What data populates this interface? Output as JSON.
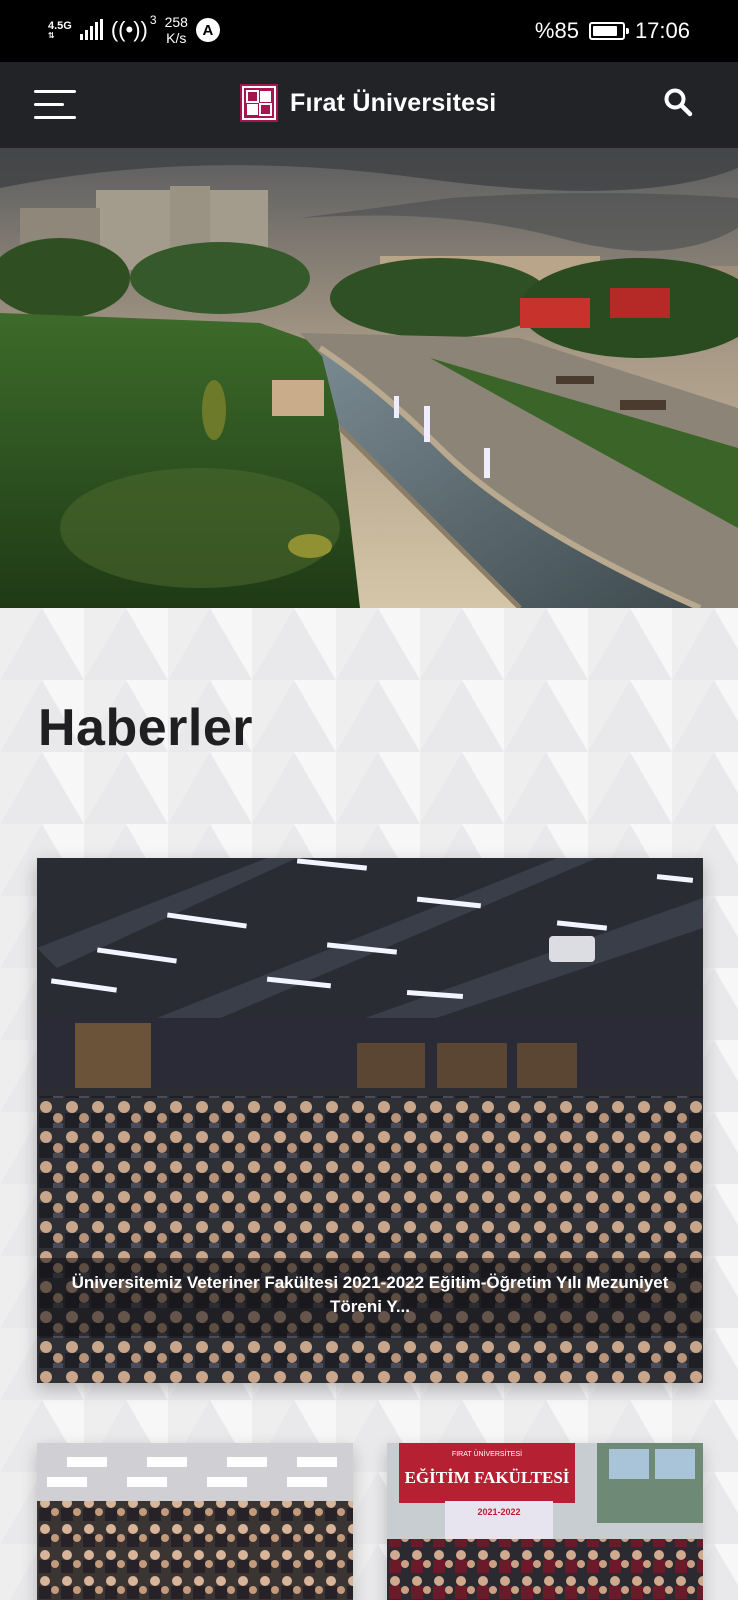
{
  "status_bar": {
    "network": "4.5G",
    "hotspot_count": "3",
    "speed_value": "258",
    "speed_unit": "K/s",
    "notification_glyph": "A",
    "battery": "%85",
    "battery_level": 0.85,
    "time": "17:06"
  },
  "header": {
    "brand": "Fırat Üniversitesi",
    "menu_icon": "hamburger-menu-icon",
    "search_icon": "search-icon"
  },
  "colors": {
    "header_bg": "#222327",
    "logo_accent": "#a3164f",
    "page_bg": "#f3f3f4"
  },
  "news": {
    "title": "Haberler",
    "featured": {
      "caption": "Üniversitemiz Veteriner Fakültesi 2021-2022 Eğitim-Öğretim Yılı Mezuniyet Töreni Y..."
    },
    "small_cards": [
      {
        "sign_line1": "",
        "sign_line2": ""
      },
      {
        "sign_line1": "FIRAT ÜNİVERSİTESİ",
        "sign_line2": "EĞİTİM FAKÜLTESİ",
        "banner": "2021-2022"
      }
    ]
  }
}
